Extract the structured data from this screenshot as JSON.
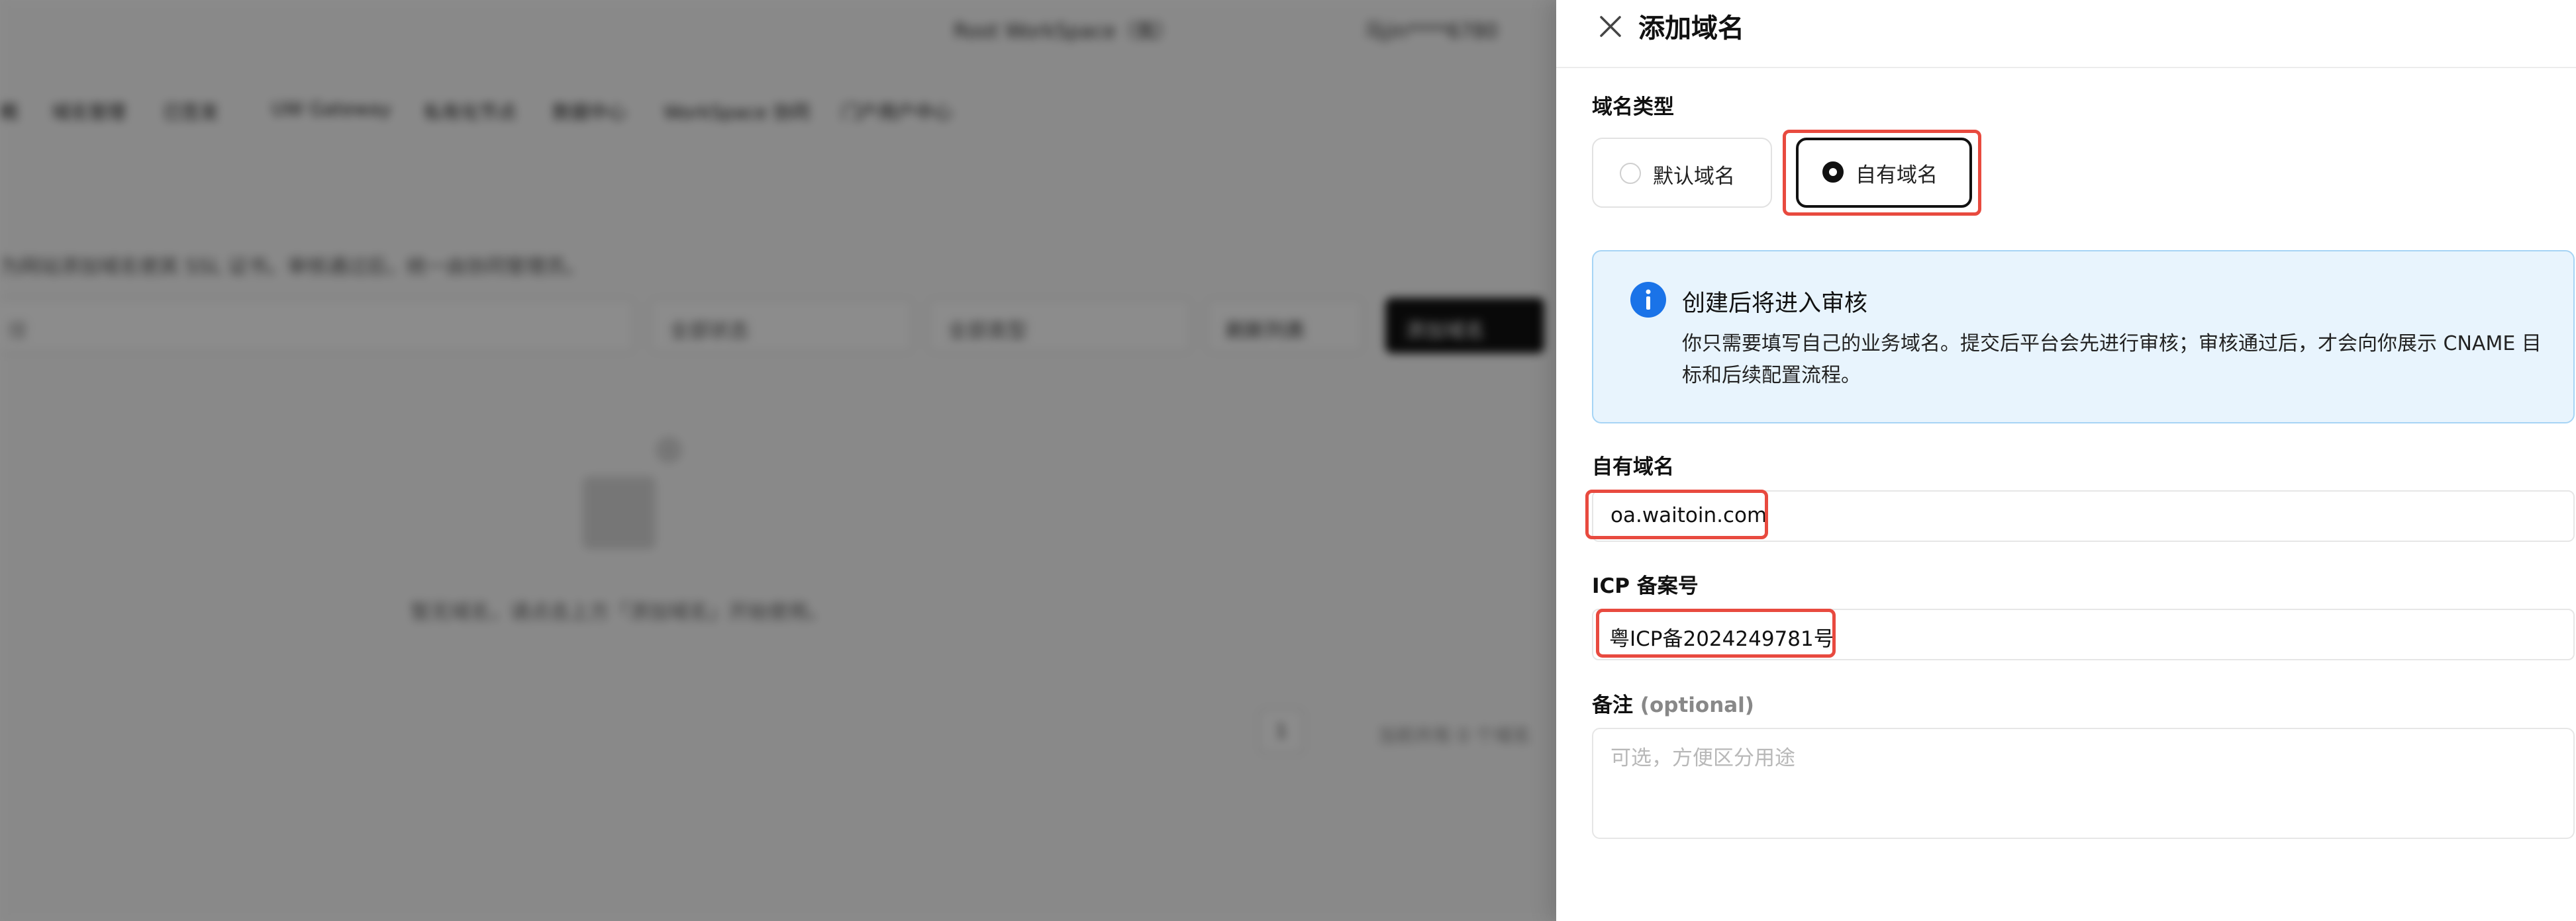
{
  "background": {
    "workspace_selector": "Root WorkSpace（我）",
    "account_label": "马jin****6780",
    "nav_tabs": [
      "概",
      "域名管理",
      "已签发",
      "UW Gateway",
      "私有化节点",
      "数据中心",
      "WorkSpace 协同",
      "门户用户中心"
    ],
    "hint_text": "为网站添加域名使其 SSL 证书。审核通过后，统一由协同管理员。",
    "search_placeholder": "搜",
    "filter_status": "全部状态",
    "filter_type": "全部类型",
    "refresh_label": "刷新列表",
    "add_domain_label": "添加域名",
    "empty_text": "暂无域名，请点击上方「添加域名」开始使用。",
    "page_number": "1",
    "pagination_info": "当前共有 0 个域名"
  },
  "drawer": {
    "title": "添加域名",
    "domain_type_label": "域名类型",
    "options": [
      {
        "label": "默认域名",
        "selected": false
      },
      {
        "label": "自有域名",
        "selected": true
      }
    ],
    "info": {
      "title": "创建后将进入审核",
      "body": "你只需要填写自己的业务域名。提交后平台会先进行审核；审核通过后，才会向你展示 CNAME 目标和后续配置流程。"
    },
    "own_domain_label": "自有域名",
    "own_domain_value": "oa.waitoin.com",
    "icp_label": "ICP 备案号",
    "icp_value": "粤ICP备2024249781号",
    "remark_label": "备注",
    "remark_optional": "(optional)",
    "remark_placeholder": "可选，方便区分用途"
  },
  "colors": {
    "highlight_red": "#e84a3f",
    "info_bg": "#e8f4fd",
    "info_border": "#a6d4f5",
    "info_icon": "#1a73e8"
  }
}
